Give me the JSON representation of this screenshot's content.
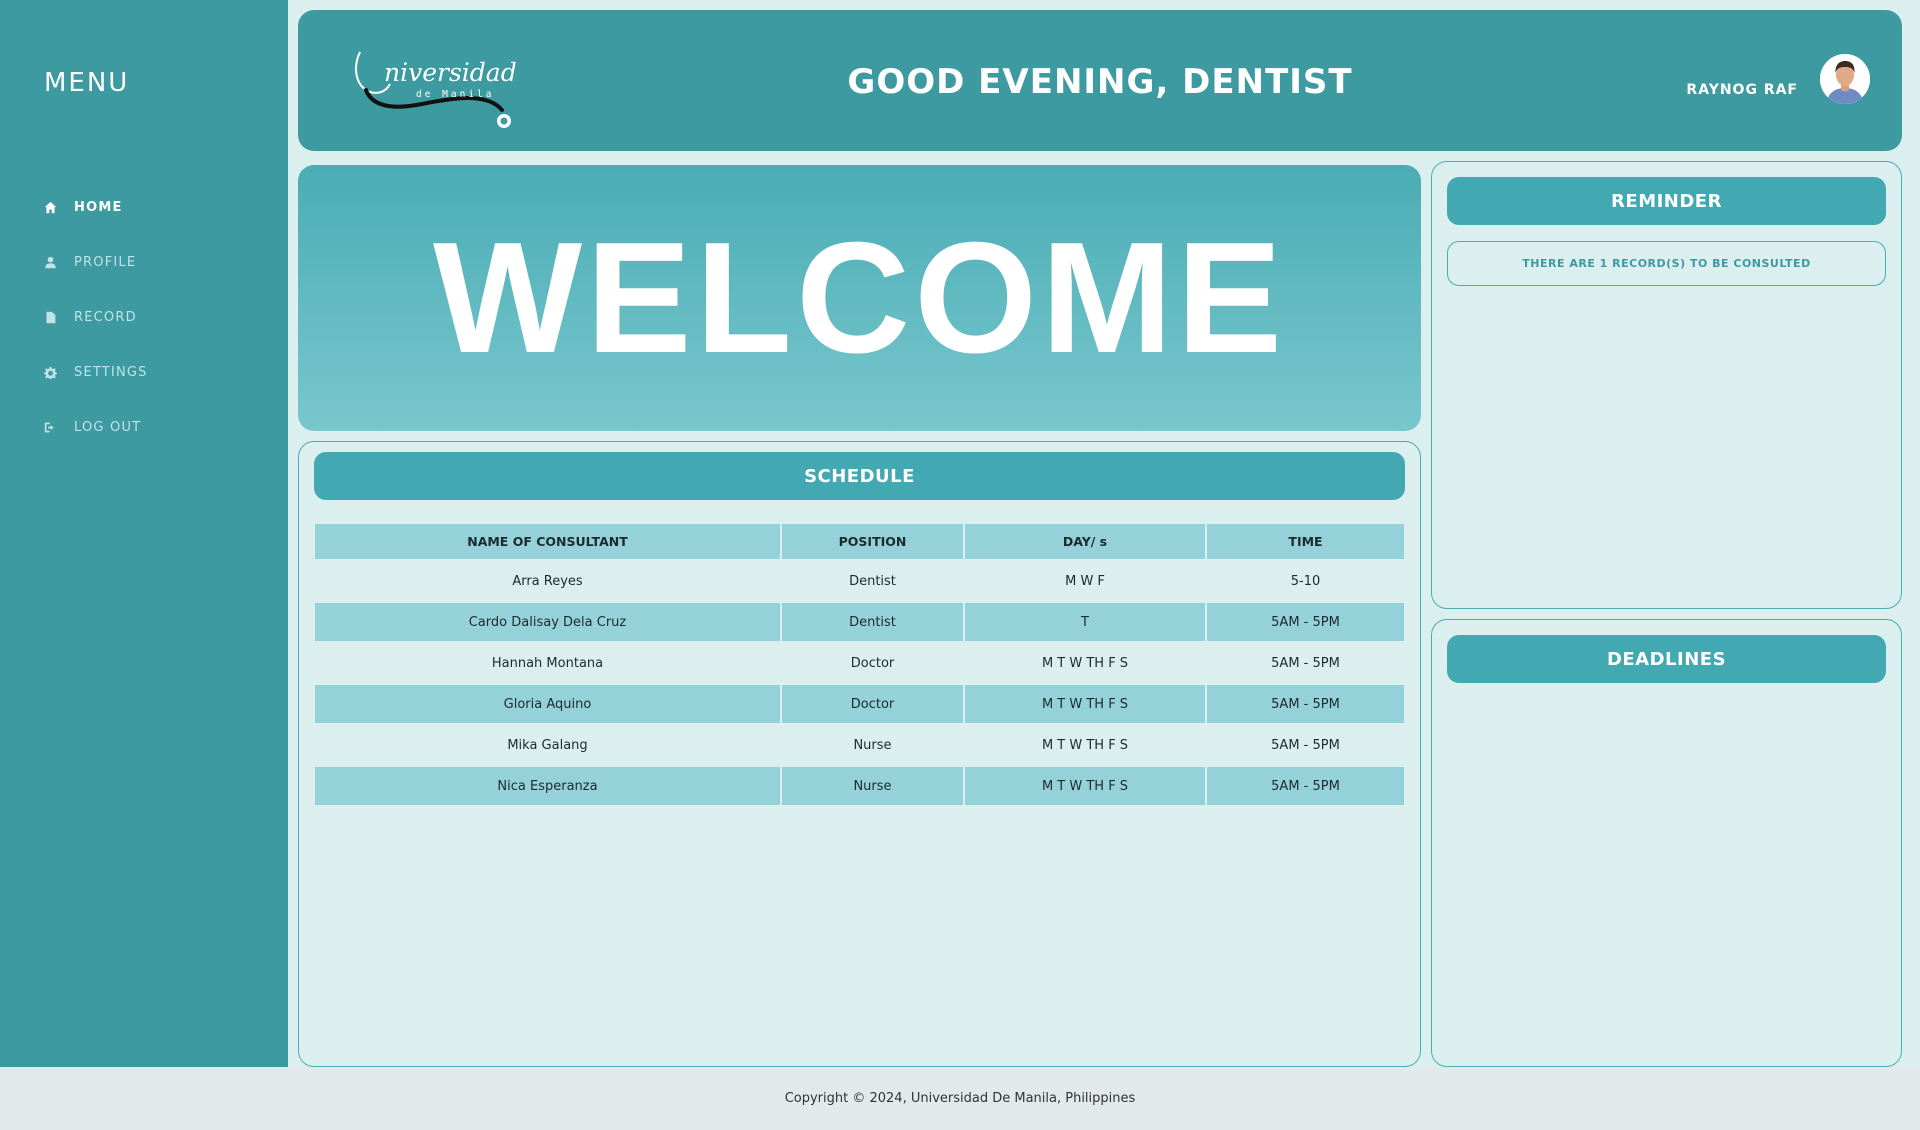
{
  "sidebar": {
    "title": "MENU",
    "items": [
      {
        "label": "HOME",
        "icon": "home-icon",
        "active": true
      },
      {
        "label": "PROFILE",
        "icon": "user-icon"
      },
      {
        "label": "RECORD",
        "icon": "file-icon"
      },
      {
        "label": "SETTINGS",
        "icon": "gear-icon"
      },
      {
        "label": "LOG OUT",
        "icon": "logout-icon"
      }
    ]
  },
  "header": {
    "logo_text": "niversidad",
    "logo_sub": "de Manila",
    "greeting": "GOOD EVENING, DENTIST",
    "user_name": "RAYNOG RAF"
  },
  "welcome": {
    "text": "WELCOME"
  },
  "schedule": {
    "title": "SCHEDULE",
    "columns": [
      "NAME OF CONSULTANT",
      "POSITION",
      "DAY/ s",
      "TIME"
    ],
    "rows": [
      [
        "Arra Reyes",
        "Dentist",
        "M W F",
        "5-10"
      ],
      [
        "Cardo Dalisay Dela Cruz",
        "Dentist",
        "T",
        "5AM - 5PM"
      ],
      [
        "Hannah Montana",
        "Doctor",
        "M T W TH F S",
        "5AM - 5PM"
      ],
      [
        "Gloria Aquino",
        "Doctor",
        "M T W TH F S",
        "5AM - 5PM"
      ],
      [
        "Mika Galang",
        "Nurse",
        "M T W TH F S",
        "5AM - 5PM"
      ],
      [
        "Nica Esperanza",
        "Nurse",
        "M T W TH F S",
        "5AM - 5PM"
      ]
    ]
  },
  "reminder": {
    "title": "REMINDER",
    "message": "THERE ARE 1 RECORD(S) TO BE CONSULTED"
  },
  "deadlines": {
    "title": "DEADLINES"
  },
  "footer": {
    "copyright": "Copyright © 2024, Universidad De Manila, Philippines"
  },
  "colors": {
    "primary": "#3d9aa1",
    "header_bar": "#42a8b1",
    "table_stripe": "#95d1d9",
    "background": "#dcefef"
  }
}
